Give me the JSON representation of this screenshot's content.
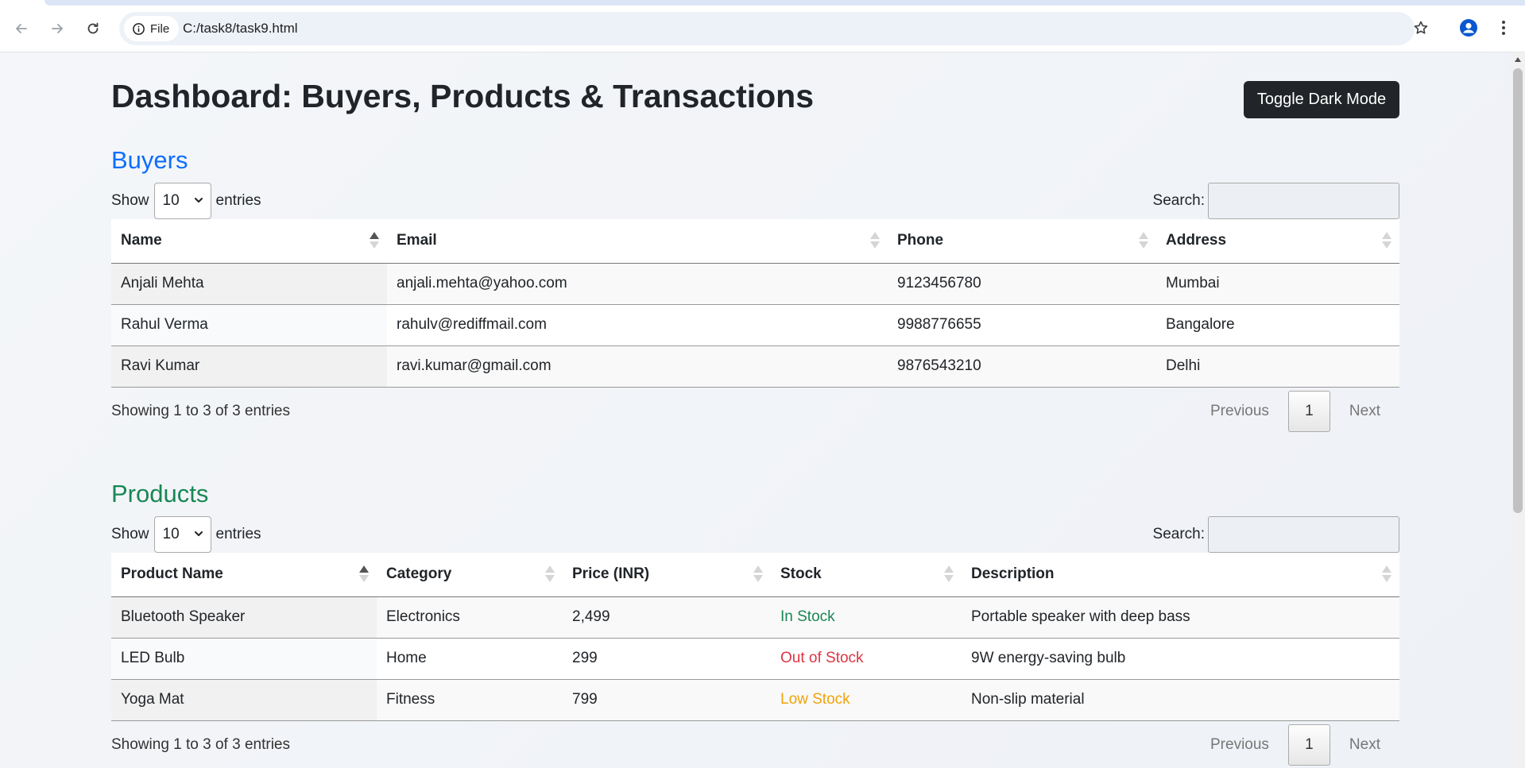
{
  "browser": {
    "site_chip_label": "File",
    "url": "C:/task8/task9.html"
  },
  "page": {
    "title": "Dashboard: Buyers, Products & Transactions",
    "toggle_label": "Toggle Dark Mode"
  },
  "colors": {
    "buyers_heading": "#0d6efd",
    "products_heading": "#198754",
    "in_stock": "#198754",
    "out_of_stock": "#dc3545",
    "low_stock": "#f0a30a",
    "dark_button": "#212529"
  },
  "buyers": {
    "heading": "Buyers",
    "length": {
      "show": "Show",
      "value": "10",
      "entries": "entries"
    },
    "search_label": "Search:",
    "columns": [
      "Name",
      "Email",
      "Phone",
      "Address"
    ],
    "rows": [
      [
        "Anjali Mehta",
        "anjali.mehta@yahoo.com",
        "9123456780",
        "Mumbai"
      ],
      [
        "Rahul Verma",
        "rahulv@rediffmail.com",
        "9988776655",
        "Bangalore"
      ],
      [
        "Ravi Kumar",
        "ravi.kumar@gmail.com",
        "9876543210",
        "Delhi"
      ]
    ],
    "info": "Showing 1 to 3 of 3 entries",
    "paging": {
      "previous": "Previous",
      "current": "1",
      "next": "Next"
    }
  },
  "products": {
    "heading": "Products",
    "length": {
      "show": "Show",
      "value": "10",
      "entries": "entries"
    },
    "search_label": "Search:",
    "columns": [
      "Product Name",
      "Category",
      "Price (INR)",
      "Stock",
      "Description"
    ],
    "rows": [
      [
        "Bluetooth Speaker",
        "Electronics",
        "2,499",
        "In Stock",
        "Portable speaker with deep bass"
      ],
      [
        "LED Bulb",
        "Home",
        "299",
        "Out of Stock",
        "9W energy-saving bulb"
      ],
      [
        "Yoga Mat",
        "Fitness",
        "799",
        "Low Stock",
        "Non-slip material"
      ]
    ],
    "info": "Showing 1 to 3 of 3 entries",
    "paging": {
      "previous": "Previous",
      "current": "1",
      "next": "Next"
    }
  }
}
